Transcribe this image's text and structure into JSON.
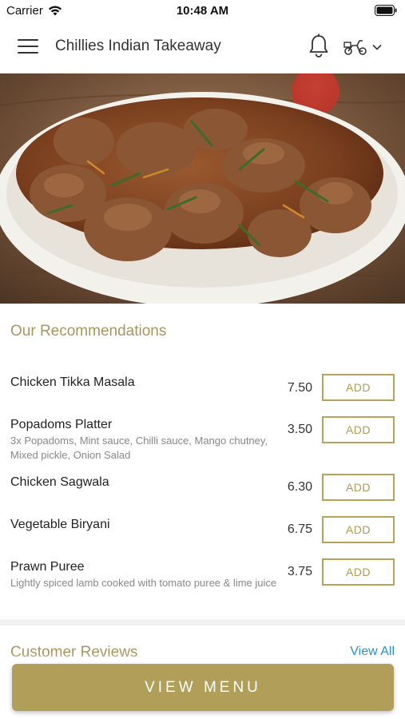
{
  "status_bar": {
    "carrier": "Carrier",
    "time": "10:48 AM"
  },
  "header": {
    "title": "Chillies Indian Takeaway"
  },
  "recommendations": {
    "title": "Our Recommendations",
    "items": [
      {
        "name": "Chicken Tikka Masala",
        "description": "",
        "price": "7.50",
        "add_label": "ADD"
      },
      {
        "name": "Popadoms Platter",
        "description": "3x Popadoms, Mint sauce, Chilli sauce, Mango chutney, Mixed pickle, Onion Salad",
        "price": "3.50",
        "add_label": "ADD"
      },
      {
        "name": "Chicken Sagwala",
        "description": "",
        "price": "6.30",
        "add_label": "ADD"
      },
      {
        "name": "Vegetable Biryani",
        "description": "",
        "price": "6.75",
        "add_label": "ADD"
      },
      {
        "name": "Prawn Puree",
        "description": "Lightly spiced lamb cooked with tomato puree & lime juice",
        "price": "3.75",
        "add_label": "ADD"
      }
    ]
  },
  "reviews": {
    "title": "Customer Reviews",
    "view_all_label": "View All"
  },
  "footer": {
    "view_menu_label": "VIEW MENU"
  },
  "theme": {
    "accent": "#b19e58",
    "link": "#2a8fd0"
  },
  "icons": [
    "wifi-icon",
    "battery-icon",
    "hamburger-menu-icon",
    "bell-icon",
    "scooter-icon",
    "chevron-down-icon"
  ]
}
